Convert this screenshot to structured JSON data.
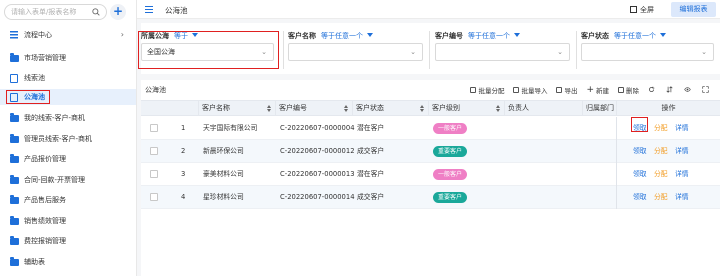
{
  "sidebar": {
    "search_placeholder": "请输入表单/报表名称",
    "items": [
      {
        "label": "流程中心",
        "icon": "list-icon",
        "chevron": "›"
      },
      {
        "label": "市场营销管理",
        "icon": "folder-icon"
      },
      {
        "label": "线索池",
        "icon": "document-icon"
      },
      {
        "label": "公海池",
        "icon": "document-icon",
        "active": true
      },
      {
        "label": "我的线索-客户-商机",
        "icon": "folder-icon"
      },
      {
        "label": "管理员线索-客户-商机",
        "icon": "folder-icon"
      },
      {
        "label": "产品报价管理",
        "icon": "folder-icon"
      },
      {
        "label": "合同-回款-开票管理",
        "icon": "folder-icon"
      },
      {
        "label": "产品售后服务",
        "icon": "folder-icon"
      },
      {
        "label": "销售绩效管理",
        "icon": "folder-icon"
      },
      {
        "label": "费控报销管理",
        "icon": "folder-icon"
      },
      {
        "label": "辅助表",
        "icon": "folder-icon"
      }
    ]
  },
  "topbar": {
    "title": "公海池",
    "fullscreen_label": "全屏",
    "edit_label": "编辑报表"
  },
  "filters": [
    {
      "label": "所属公海",
      "operator": "等于",
      "value": "全国公海"
    },
    {
      "label": "客户名称",
      "operator": "等于任意一个",
      "value": ""
    },
    {
      "label": "客户编号",
      "operator": "等于任意一个",
      "value": ""
    },
    {
      "label": "客户状态",
      "operator": "等于任意一个",
      "value": ""
    }
  ],
  "table": {
    "title": "公海池",
    "toolbar": {
      "batch_assign": "批量分配",
      "batch_import": "批量导入",
      "export": "导出",
      "create": "新建",
      "delete": "删除"
    },
    "columns": [
      "客户名称",
      "客户编号",
      "客户状态",
      "客户级别",
      "负责人",
      "归属部门",
      "操作"
    ],
    "rows": [
      {
        "index": "1",
        "name": "天宇国际有限公司",
        "code": "C-20220607-0000004",
        "status": "潜在客户",
        "level": "一般客户",
        "level_type": "normal"
      },
      {
        "index": "2",
        "name": "新晨环保公司",
        "code": "C-20220607-0000012",
        "status": "成交客户",
        "level": "重要客户",
        "level_type": "vip"
      },
      {
        "index": "3",
        "name": "豪美材料公司",
        "code": "C-20220607-0000013",
        "status": "潜在客户",
        "level": "一般客户",
        "level_type": "normal"
      },
      {
        "index": "4",
        "name": "星珍材料公司",
        "code": "C-20220607-0000014",
        "status": "成交客户",
        "level": "重要客户",
        "level_type": "vip"
      }
    ],
    "actions": {
      "claim": "领取",
      "assign": "分配",
      "detail": "详情"
    }
  },
  "colors": {
    "accent": "#1e6fd9",
    "highlight": "#e02020",
    "assign": "#f29a1e",
    "badge_normal": "#ef7fc5",
    "badge_vip": "#1aa89a"
  }
}
